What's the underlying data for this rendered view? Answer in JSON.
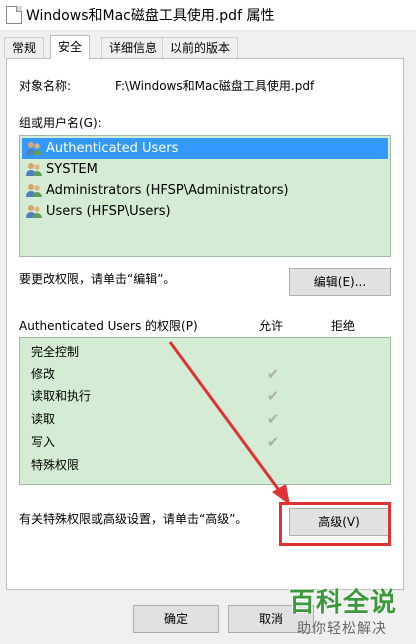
{
  "window": {
    "title": "Windows和Mac磁盘工具使用.pdf 属性"
  },
  "tabs": [
    {
      "label": "常规"
    },
    {
      "label": "安全"
    },
    {
      "label": "详细信息"
    },
    {
      "label": "以前的版本"
    }
  ],
  "active_tab": "安全",
  "object": {
    "label": "对象名称:",
    "value": "F:\\Windows和Mac磁盘工具使用.pdf"
  },
  "groups": {
    "label": "组或用户名(G):",
    "items": [
      {
        "label": "Authenticated Users",
        "selected": true
      },
      {
        "label": "SYSTEM",
        "selected": false
      },
      {
        "label": "Administrators (HFSP\\Administrators)",
        "selected": false
      },
      {
        "label": "Users (HFSP\\Users)",
        "selected": false
      }
    ]
  },
  "edit": {
    "hint": "要更改权限，请单击“编辑”。",
    "button": "编辑(E)..."
  },
  "permissions": {
    "header": "Authenticated Users 的权限(P)",
    "allow_col": "允许",
    "deny_col": "拒绝",
    "check_glyph": "✔",
    "rows": [
      {
        "name": "完全控制",
        "allow": false,
        "deny": false
      },
      {
        "name": "修改",
        "allow": true,
        "deny": false
      },
      {
        "name": "读取和执行",
        "allow": true,
        "deny": false
      },
      {
        "name": "读取",
        "allow": true,
        "deny": false
      },
      {
        "name": "写入",
        "allow": true,
        "deny": false
      },
      {
        "name": "特殊权限",
        "allow": false,
        "deny": false
      }
    ]
  },
  "advanced": {
    "hint": "有关特殊权限或高级设置，请单击“高级”。",
    "button": "高级(V)"
  },
  "footer": {
    "ok": "确定",
    "cancel": "取消"
  },
  "watermark": {
    "main": "百科全说",
    "sub": "助你轻松解决"
  },
  "colors": {
    "list_bg": "#d3ecd3",
    "selection": "#3399ff",
    "highlight": "#e03232",
    "watermark": "#3a9a3a"
  }
}
